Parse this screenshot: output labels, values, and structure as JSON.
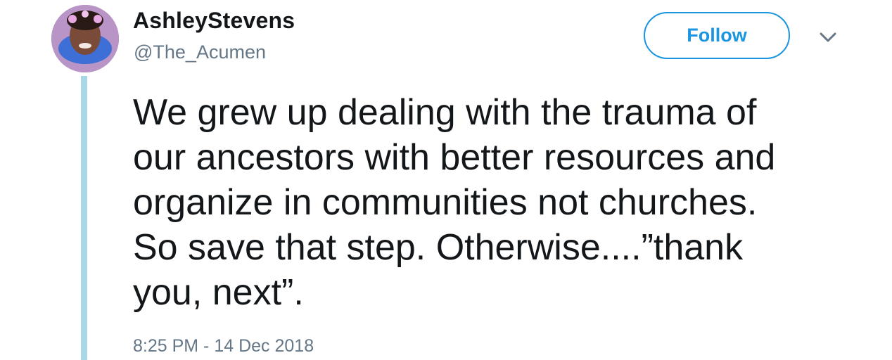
{
  "tweet": {
    "author": {
      "display_name": "AshleyStevens",
      "handle": "@The_Acumen",
      "avatar_icon": "profile-photo"
    },
    "follow_label": "Follow",
    "menu_icon": "chevron-down-icon",
    "text_lines": [
      "We grew up dealing with the trauma of",
      "our ancestors with better resources and",
      "organize in communities not churches.",
      "So save that step. Otherwise....”thank",
      "you, next”."
    ],
    "timestamp": "8:25 PM - 14 Dec 2018"
  },
  "colors": {
    "accent": "#1b95e0",
    "thread_line": "#a8d7e6",
    "primary_text": "#14171a",
    "secondary_text": "#657786"
  }
}
